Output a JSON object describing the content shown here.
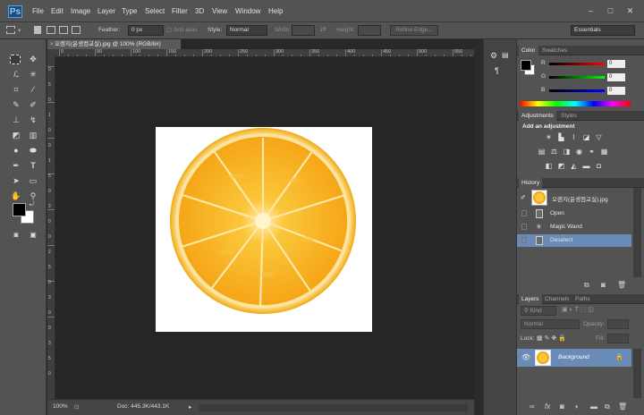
{
  "app": {
    "logo": "Ps"
  },
  "menu": [
    "File",
    "Edit",
    "Image",
    "Layer",
    "Type",
    "Select",
    "Filter",
    "3D",
    "View",
    "Window",
    "Help"
  ],
  "window_controls": {
    "minimize": "–",
    "maximize": "□",
    "close": "✕"
  },
  "options": {
    "feather_label": "Feather:",
    "feather_value": "0 px",
    "antialias_label": "Anti-alias",
    "style_label": "Style:",
    "style_value": "Normal",
    "width_label": "Width:",
    "height_label": "Height:",
    "refine_edge": "Refine Edge...",
    "workspace": "Essentials"
  },
  "document": {
    "tab_title": "오렌지(윤생컴교실).jpg @ 100% (RGB/8#)",
    "close": "×",
    "ruler_labels": [
      "0",
      "50",
      "100",
      "150",
      "200",
      "250",
      "300",
      "350",
      "400",
      "450",
      "500",
      "550"
    ],
    "vruler_labels": [
      "0",
      "5",
      "0",
      "1",
      "0",
      "0",
      "1",
      "5",
      "0",
      "2",
      "0",
      "0",
      "2",
      "5",
      "0",
      "3",
      "0",
      "0",
      "3",
      "5",
      "0"
    ],
    "status": {
      "zoom": "100%",
      "doc": "Doc: 445.3K/443.1K"
    }
  },
  "color_panel": {
    "tabs": [
      "Color",
      "Swatches"
    ],
    "channels": [
      {
        "label": "R",
        "value": "0",
        "color": "#e03c3c"
      },
      {
        "label": "G",
        "value": "0",
        "color": "#3cc03c"
      },
      {
        "label": "B",
        "value": "0",
        "color": "#3c5ce0"
      }
    ]
  },
  "adjustments_panel": {
    "tabs": [
      "Adjustments",
      "Styles"
    ],
    "heading": "Add an adjustment",
    "icons": [
      "brightness-icon",
      "levels-icon",
      "curves-icon",
      "exposure-icon",
      "vibrance-icon",
      "hue-saturation-icon",
      "color-balance-icon",
      "black-white-icon",
      "photo-filter-icon",
      "channel-mixer-icon",
      "color-lookup-icon",
      "invert-icon",
      "posterize-icon",
      "threshold-icon",
      "gradient-map-icon",
      "selective-color-icon"
    ]
  },
  "history_panel": {
    "tab": "History",
    "snapshot": "오렌지(윤생컴교실).jpg",
    "items": [
      "Open",
      "Magic Wand",
      "Deselect"
    ]
  },
  "layers_panel": {
    "tabs": [
      "Layers",
      "Channels",
      "Paths"
    ],
    "kind_label": "Kind",
    "blend_mode": "Normal",
    "opacity_label": "Opacity:",
    "lock_label": "Lock:",
    "fill_label": "Fill:",
    "layer_name": "Background"
  },
  "colors": {
    "accent_selected": "#6a8bb5",
    "fg": "#000000",
    "bg": "#ffffff"
  }
}
